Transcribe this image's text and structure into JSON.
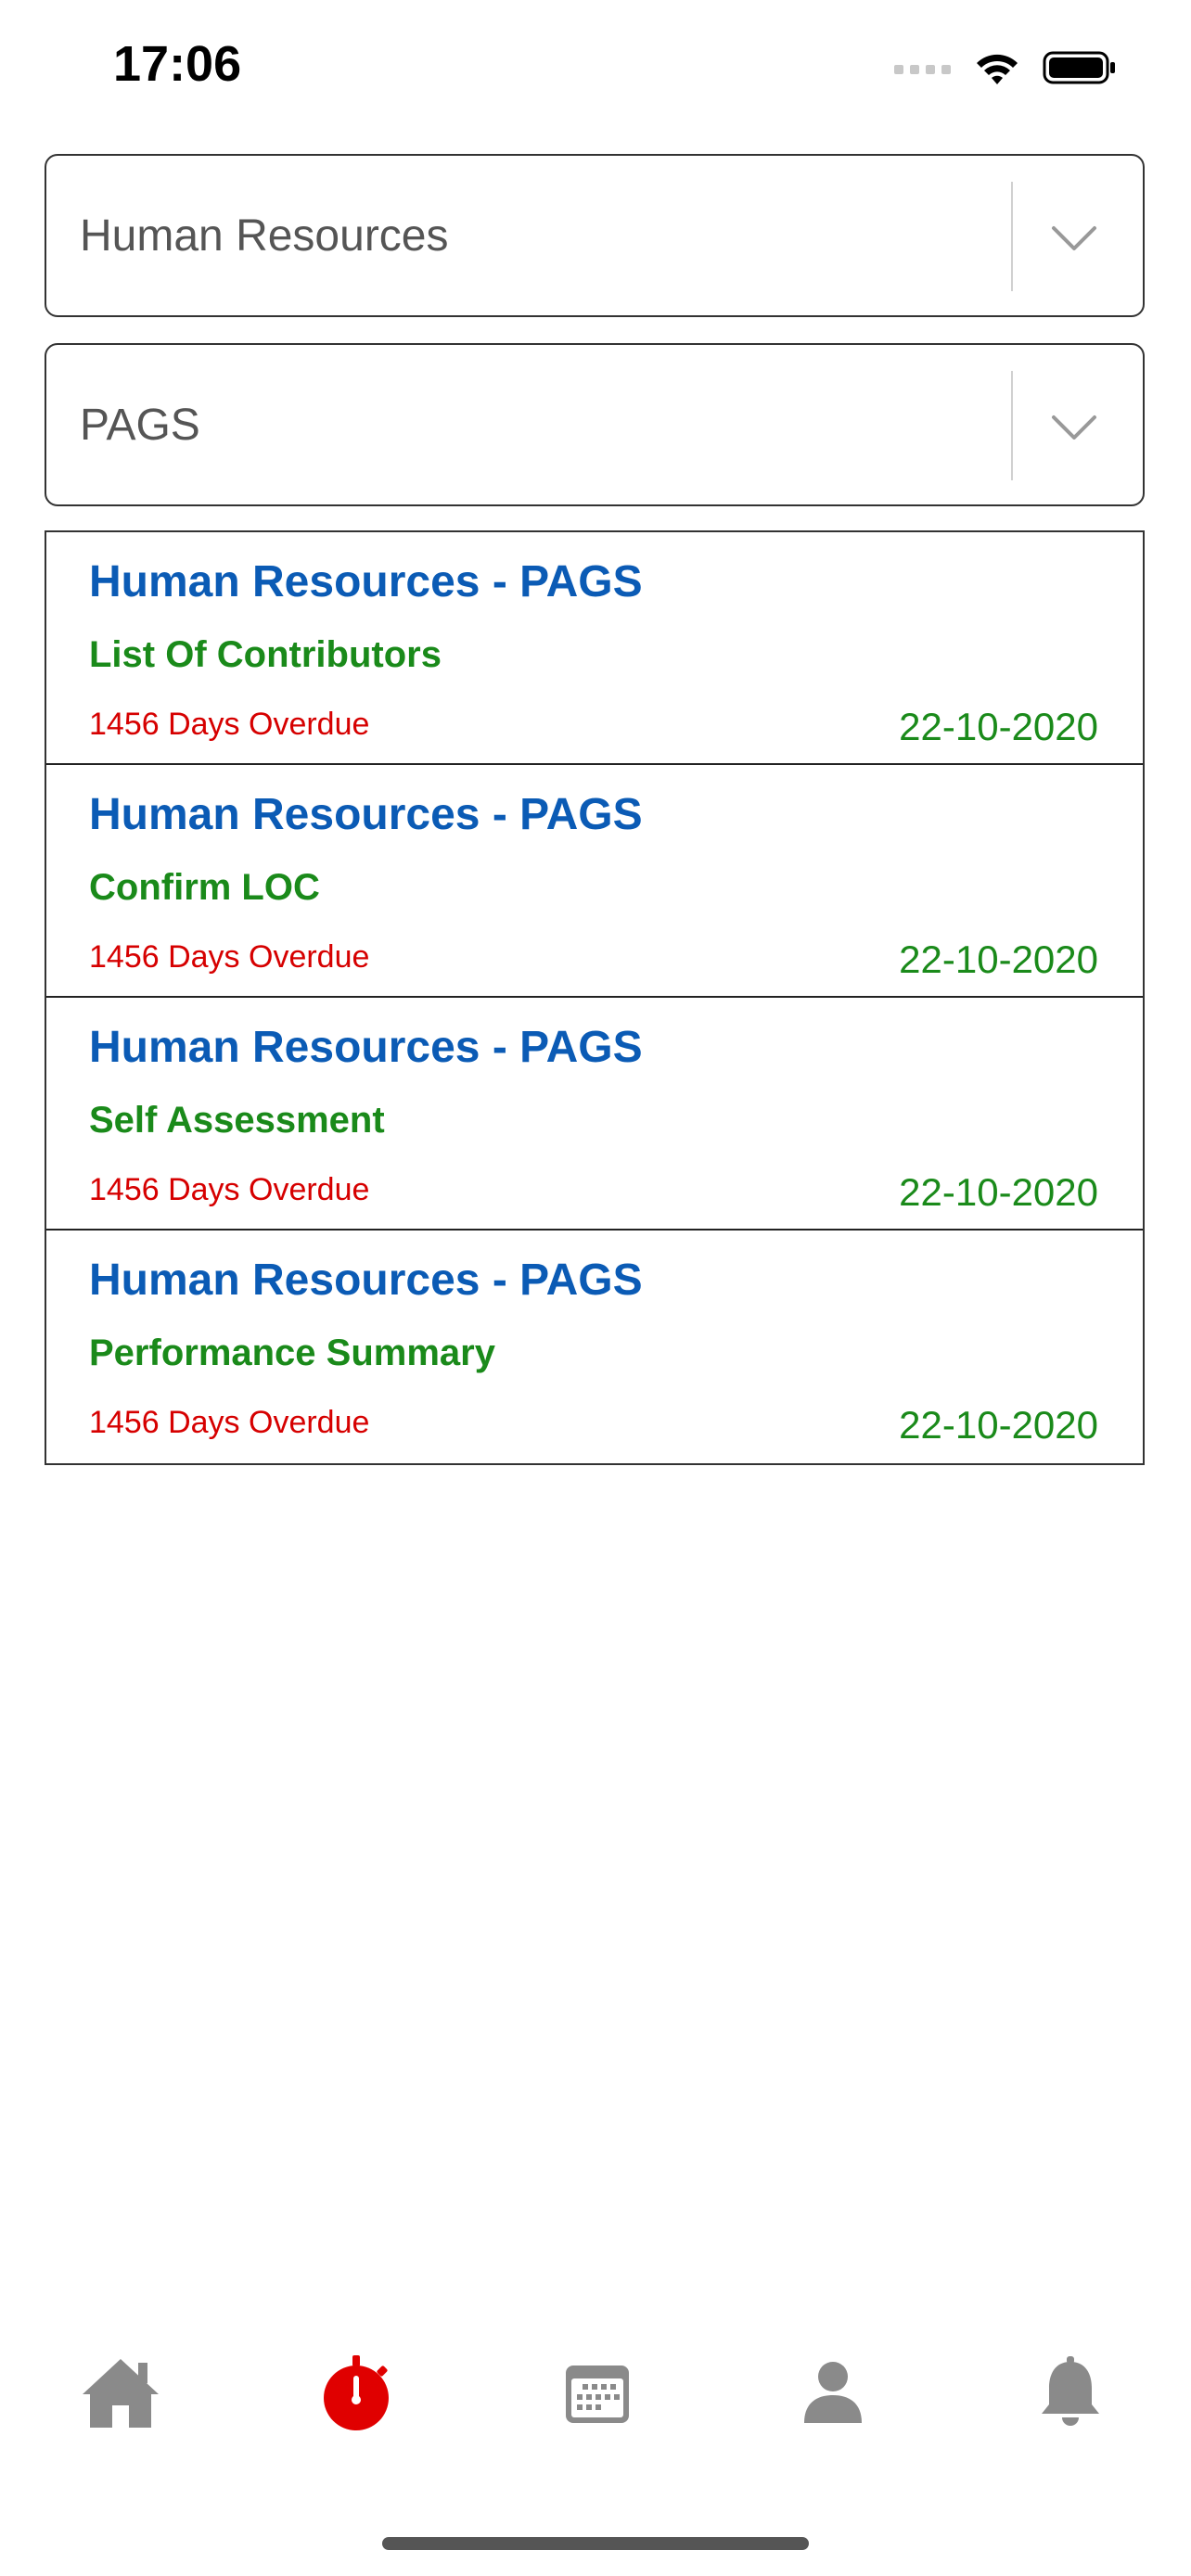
{
  "status_bar": {
    "time": "17:06"
  },
  "filters": {
    "department": "Human Resources",
    "category": "PAGS"
  },
  "tasks": [
    {
      "title": "Human Resources - PAGS",
      "subtitle": "List Of Contributors",
      "overdue": "1456 Days Overdue",
      "date": "22-10-2020"
    },
    {
      "title": "Human Resources - PAGS",
      "subtitle": "Confirm LOC",
      "overdue": "1456 Days Overdue",
      "date": "22-10-2020"
    },
    {
      "title": "Human Resources - PAGS",
      "subtitle": "Self Assessment",
      "overdue": "1456 Days Overdue",
      "date": "22-10-2020"
    },
    {
      "title": "Human Resources - PAGS",
      "subtitle": "Performance Summary",
      "overdue": "1456 Days Overdue",
      "date": "22-10-2020"
    }
  ],
  "tabbar": {
    "items": [
      "home-icon",
      "timer-icon",
      "calendar-icon",
      "profile-icon",
      "bell-icon"
    ],
    "active": "timer-icon"
  },
  "colors": {
    "title_blue": "#0b5bb5",
    "subtitle_green": "#1a8a1a",
    "overdue_red": "#d60000",
    "active_tab_red": "#e00000",
    "inactive_tab_gray": "#8a8a8a"
  }
}
